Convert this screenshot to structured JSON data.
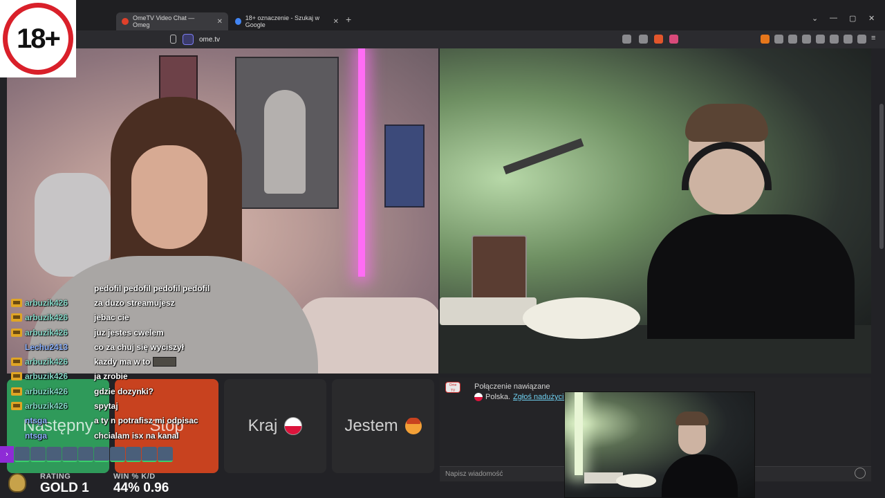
{
  "age_badge": "18+",
  "browser": {
    "tabs": [
      {
        "label": "OmeTV Video Chat — Omeg",
        "favicon_color": "#e0402a"
      },
      {
        "label": "18+ oznaczenie - Szukaj w Google",
        "favicon_color": "#4285f4"
      }
    ],
    "url": "ome.tv"
  },
  "stream_chat": [
    {
      "user": "",
      "message": "pedofil pedofil pedofil pedofil",
      "crown": false
    },
    {
      "user": "arbuzik426",
      "message": "za duzo streamujesz",
      "crown": true
    },
    {
      "user": "arbuzik426",
      "message": "jebac cie",
      "crown": true
    },
    {
      "user": "arbuzik426",
      "message": "juz jestes cwelem",
      "crown": true
    },
    {
      "user": "Lechu2413",
      "message": "co za chuj się wyciszył",
      "crown": false
    },
    {
      "user": "arbuzik426",
      "message": "kazdy ma w to",
      "crown": true
    },
    {
      "user": "arbuzik426",
      "message": "ja zrobie",
      "crown": true
    },
    {
      "user": "arbuzik426",
      "message": "gdzie dozynki?",
      "crown": true
    },
    {
      "user": "arbuzik426",
      "message": "spytaj",
      "crown": true
    },
    {
      "user": "ntsga",
      "message": "a ty n potrafisz mi odpisac",
      "crown": false
    },
    {
      "user": "ntsga",
      "message": "chcialam isx na kanal",
      "crown": false
    }
  ],
  "buttons": {
    "next": "Następny",
    "stop": "Stop",
    "country": "Kraj",
    "gender": "Jestem"
  },
  "chat_panel": {
    "status": "Połączenie nawiązane",
    "country": "Polska.",
    "report": "Zgłoś nadużycie.",
    "placeholder": "Napisz wiadomość"
  },
  "game_stats": {
    "rating_label": "RATING",
    "rating_value": "GOLD 1",
    "win_label": "WIN % K/D",
    "win_value": "44% 0.96"
  },
  "colors": {
    "next": "#2f9a5a",
    "stop": "#c8421f",
    "badge_red": "#d9202a"
  }
}
